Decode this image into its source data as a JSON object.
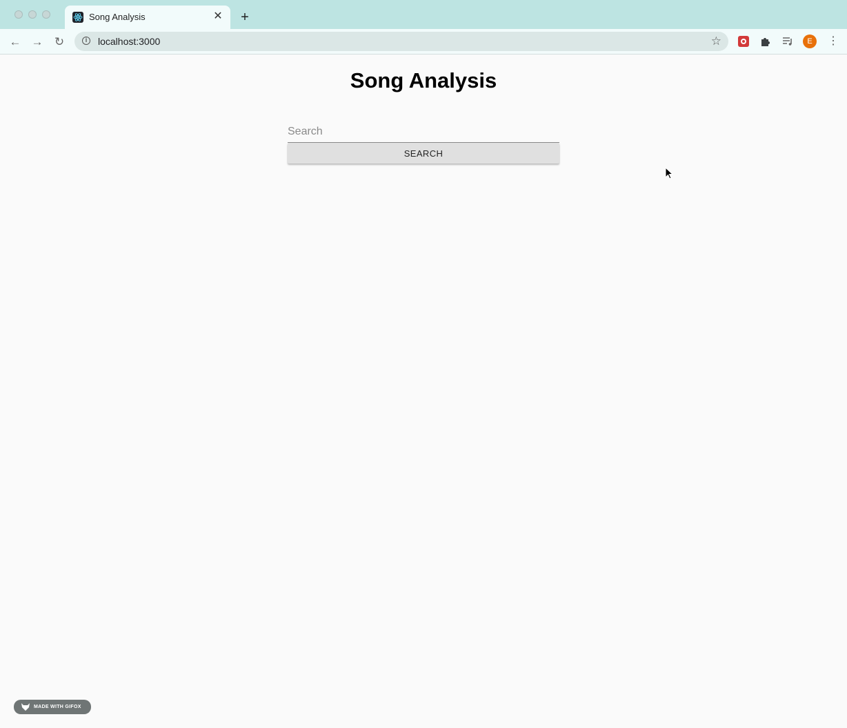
{
  "browser": {
    "tab": {
      "title": "Song Analysis",
      "close_glyph": "✕"
    },
    "new_tab_glyph": "+",
    "url": "localhost:3000",
    "nav": {
      "back_glyph": "←",
      "forward_glyph": "→",
      "reload_glyph": "↻"
    },
    "star_glyph": "☆",
    "avatar_letter": "E",
    "menu_glyph": "⋮",
    "extensions": [
      "extension-red-icon",
      "puzzle-icon",
      "media-queue-icon"
    ]
  },
  "page": {
    "title": "Song Analysis",
    "search": {
      "placeholder": "Search",
      "value": "",
      "button_label": "SEARCH"
    }
  },
  "overlay": {
    "badge_text": "MADE WITH GIFOX"
  },
  "colors": {
    "titlebar": "#bde4e2",
    "toolbar": "#f2fbfb",
    "avatar": "#e8710a",
    "button": "#e0e0e0"
  }
}
